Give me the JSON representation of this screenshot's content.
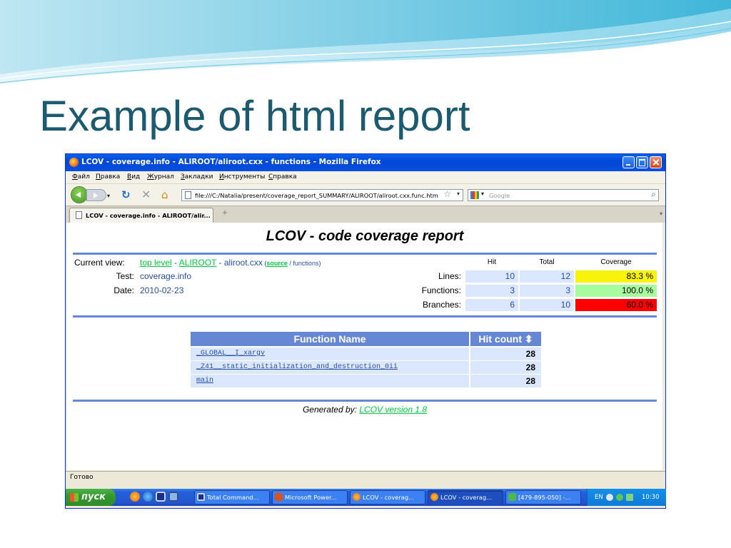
{
  "slide": {
    "title": "Example of html report"
  },
  "window": {
    "title": "LCOV - coverage.info - ALIROOT/aliroot.cxx - functions - Mozilla Firefox"
  },
  "menu": [
    "Файл",
    "Правка",
    "Вид",
    "Журнал",
    "Закладки",
    "Инструменты",
    "Справка"
  ],
  "navigation": {
    "url": "file:///C:/Natalia/present/coverage_report_SUMMARY/ALIROOT/aliroot.cxx.func.htm",
    "search_placeholder": "Google"
  },
  "tab": {
    "label": "LCOV - coverage.info - ALIROOT/alir..."
  },
  "report": {
    "title": "LCOV - code coverage report",
    "current_view_label": "Current view:",
    "crumb_top": "top level",
    "crumb_sep1": " - ",
    "crumb_dir": "ALIROOT",
    "crumb_sep2": " - ",
    "crumb_file": "aliroot.cxx",
    "view_open": " (",
    "view_source": "source",
    "view_sep": " / ",
    "view_functions": "functions",
    "view_close": ")",
    "test_label": "Test:",
    "test_value": "coverage.info",
    "date_label": "Date:",
    "date_value": "2010-02-23",
    "col_hit": "Hit",
    "col_total": "Total",
    "col_coverage": "Coverage",
    "stats": [
      {
        "label": "Lines:",
        "hit": "10",
        "total": "12",
        "coverage": "83.3 %",
        "level": "medium",
        "color": "#f8f30c"
      },
      {
        "label": "Functions:",
        "hit": "3",
        "total": "3",
        "coverage": "100.0 %",
        "level": "high",
        "color": "#a7fc9d"
      },
      {
        "label": "Branches:",
        "hit": "6",
        "total": "10",
        "coverage": "60.0 %",
        "level": "low",
        "color": "#ff0000"
      }
    ],
    "function_table": {
      "col_name": "Function Name",
      "col_hits": "Hit count ⬍",
      "rows": [
        {
          "name": "_GLOBAL__I_xargv",
          "hits": "28"
        },
        {
          "name": "_Z41__static_initialization_and_destruction_0ii",
          "hits": "28"
        },
        {
          "name": "main",
          "hits": "28"
        }
      ]
    },
    "generated_prefix": "Generated by: ",
    "generated_link": "LCOV version 1.8"
  },
  "status": {
    "text": "Готово"
  },
  "taskbar": {
    "start_label": "пуск",
    "buttons": [
      {
        "label": "Total Command...",
        "icon": "floppy-icon"
      },
      {
        "label": "Microsoft Power...",
        "icon": "powerpoint-icon"
      },
      {
        "label": "LCOV - coverag...",
        "icon": "firefox-icon"
      },
      {
        "label": "LCOV - coverag...",
        "icon": "firefox-icon",
        "active": true
      },
      {
        "label": "[479-895-050] -...",
        "icon": "phone-icon"
      }
    ],
    "lang": "EN",
    "clock": "10:30"
  },
  "colors": {
    "accent": "#6688d4",
    "row_bg": "#dae7fe",
    "link_green": "#00cb40",
    "link_blue": "#284fa8",
    "title_teal": "#1c5a70"
  }
}
